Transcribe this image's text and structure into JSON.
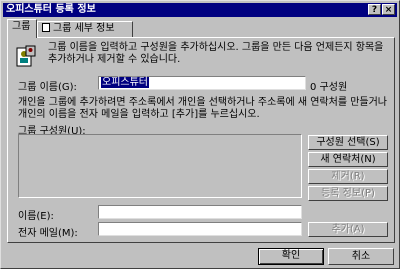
{
  "window": {
    "title": "오피스튜터 등록 정보"
  },
  "titlebar_buttons": {
    "help": "?",
    "close": "×"
  },
  "tabs": [
    {
      "label": "그룹"
    },
    {
      "label": "그룹 세부 정보"
    }
  ],
  "instructions": "그룹 이름을 입력하고 구성원을 추가하십시오. 그룹을 만든 다음 언제든지 항목을 추가하거나 제거할 수 있습니다.",
  "group_name": {
    "label": "그룹 이름(G):",
    "value": "오피스튜터",
    "member_count": "0 구성원"
  },
  "description": "개인을 그룹에 추가하려면 주소록에서 개인을 선택하거나 주소록에 새 연락처를 만들거나 개인의 이름을 전자 메일을 입력하고 [추가]를 누르십시오.",
  "members": {
    "label": "그룹 구성원(U):"
  },
  "side_buttons": {
    "select_members": "구성원 선택(S)",
    "new_contact": "새 연락처(N)",
    "remove": "제거(R)",
    "properties": "등록 정보(P)"
  },
  "name_field": {
    "label": "이름(E):",
    "value": ""
  },
  "email_field": {
    "label": "전자 메일(M):",
    "value": ""
  },
  "add_button": "추가(A)",
  "footer": {
    "ok": "확인",
    "cancel": "취소"
  }
}
